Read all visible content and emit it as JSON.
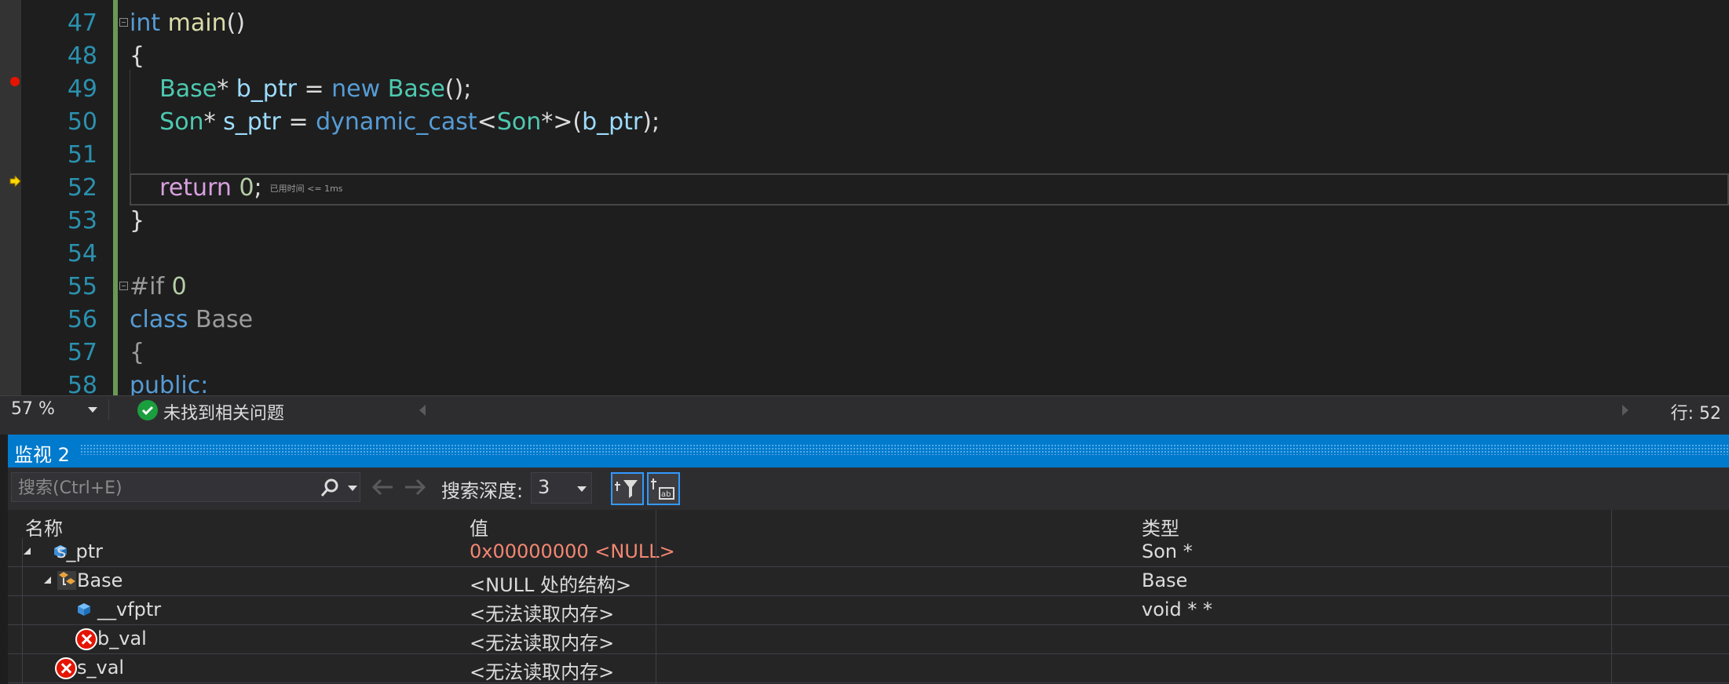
{
  "editor": {
    "lines": [
      {
        "num": "47",
        "tokens": [
          {
            "t": "int",
            "c": "kw"
          },
          {
            "t": " "
          },
          {
            "t": "main",
            "c": "fn"
          },
          {
            "t": "()",
            "c": "punct"
          }
        ]
      },
      {
        "num": "48",
        "tokens": [
          {
            "t": "{",
            "c": "punct"
          }
        ]
      },
      {
        "num": "49",
        "tokens": [
          {
            "t": "    "
          },
          {
            "t": "Base",
            "c": "type"
          },
          {
            "t": "* "
          },
          {
            "t": "b_ptr",
            "c": "var"
          },
          {
            "t": " = "
          },
          {
            "t": "new",
            "c": "kw"
          },
          {
            "t": " "
          },
          {
            "t": "Base",
            "c": "type"
          },
          {
            "t": "();"
          }
        ]
      },
      {
        "num": "50",
        "tokens": [
          {
            "t": "    "
          },
          {
            "t": "Son",
            "c": "type"
          },
          {
            "t": "* "
          },
          {
            "t": "s_ptr",
            "c": "var"
          },
          {
            "t": " = "
          },
          {
            "t": "dynamic_cast",
            "c": "kw"
          },
          {
            "t": "<"
          },
          {
            "t": "Son",
            "c": "type"
          },
          {
            "t": "*>("
          },
          {
            "t": "b_ptr",
            "c": "var"
          },
          {
            "t": ");"
          }
        ]
      },
      {
        "num": "51",
        "tokens": []
      },
      {
        "num": "52",
        "tokens": [
          {
            "t": "    "
          },
          {
            "t": "return",
            "c": "ctl"
          },
          {
            "t": " "
          },
          {
            "t": "0",
            "c": "num"
          },
          {
            "t": ";"
          }
        ]
      },
      {
        "num": "53",
        "tokens": [
          {
            "t": "}",
            "c": "punct"
          }
        ]
      },
      {
        "num": "54",
        "tokens": []
      },
      {
        "num": "55",
        "tokens": [
          {
            "t": "#if",
            "c": "pp"
          },
          {
            "t": " "
          },
          {
            "t": "0",
            "c": "num"
          }
        ]
      },
      {
        "num": "56",
        "tokens": [
          {
            "t": "class",
            "c": "kw"
          },
          {
            "t": " "
          },
          {
            "t": "Base",
            "c": "pp"
          }
        ]
      },
      {
        "num": "57",
        "tokens": [
          {
            "t": "{",
            "c": "pp"
          }
        ]
      },
      {
        "num": "58",
        "tokens": [
          {
            "t": "public:",
            "c": "kw"
          }
        ]
      }
    ],
    "timing_hint": "已用时间 <= 1ms"
  },
  "status_bar": {
    "zoom": "57 %",
    "issues": "未找到相关问题",
    "line_indicator": "行: 52"
  },
  "watch": {
    "title": "监视 2",
    "search_placeholder": "搜索(Ctrl+E)",
    "depth_label": "搜索深度:",
    "depth_value": "3",
    "columns": {
      "name": "名称",
      "value": "值",
      "type": "类型"
    },
    "rows": [
      {
        "name": "s_ptr",
        "value": "0x00000000 <NULL>",
        "type": "Son *"
      },
      {
        "name": "Base",
        "value": "<NULL 处的结构>",
        "type": "Base"
      },
      {
        "name": "__vfptr",
        "value": "<无法读取内存>",
        "type": "void * *"
      },
      {
        "name": "b_val",
        "value": "<无法读取内存>",
        "type": ""
      },
      {
        "name": "s_val",
        "value": "<无法读取内存>",
        "type": ""
      }
    ]
  },
  "colors": {
    "accent": "#007acc",
    "breakpoint": "#e51400",
    "error_value": "#f48771"
  }
}
